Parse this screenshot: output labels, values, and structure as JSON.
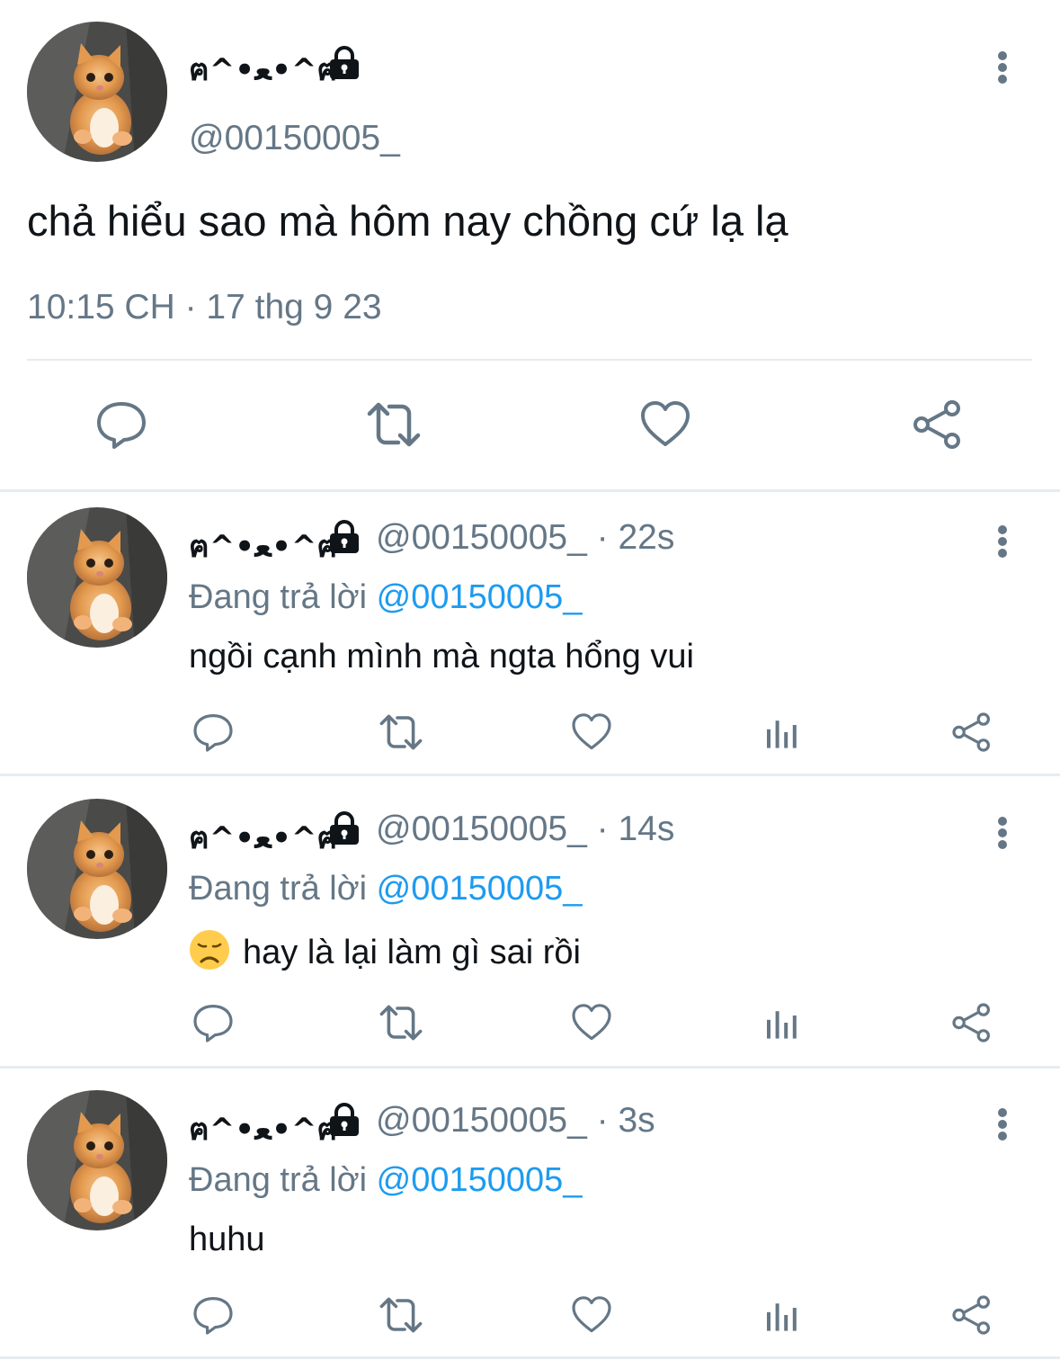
{
  "main_tweet": {
    "display_name": "ฅ^•ﻌ•^ฅ",
    "handle": "@00150005_",
    "text": "chả hiểu sao mà hôm nay chồng cứ lạ lạ",
    "timestamp": "10:15 CH · 17 thg 9 23"
  },
  "replies": [
    {
      "display_name": "ฅ^•ﻌ•^ฅ",
      "handle_time": "@00150005_ · 22s",
      "replying_prefix": "Đang trả lời ",
      "replying_mention": "@00150005_",
      "text": "ngồi cạnh mình mà ngta hổng vui"
    },
    {
      "display_name": "ฅ^•ﻌ•^ฅ",
      "handle_time": "@00150005_ · 14s",
      "replying_prefix": "Đang trả lời ",
      "replying_mention": "@00150005_",
      "emoji": "disappointed-face",
      "text": "hay là lại làm gì sai rồi"
    },
    {
      "display_name": "ฅ^•ﻌ•^ฅ",
      "handle_time": "@00150005_ · 3s",
      "replying_prefix": "Đang trả lời ",
      "replying_mention": "@00150005_",
      "text": "huhu"
    }
  ],
  "icons": {
    "reply": "speech-bubble-icon",
    "retweet": "retweet-icon",
    "like": "heart-icon",
    "stats": "bar-chart-icon",
    "share": "share-icon",
    "lock": "lock-icon",
    "more": "kebab-icon"
  },
  "colors": {
    "text": "#0f1419",
    "secondary": "#657786",
    "mention": "#1d9bf0",
    "divider": "#e6ecf0"
  }
}
